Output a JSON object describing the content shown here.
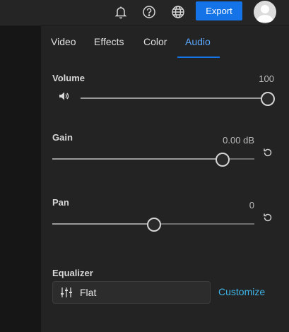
{
  "toolbar": {
    "export_label": "Export",
    "accent_color": "#1473e6",
    "icons": [
      "bell-icon",
      "help-icon",
      "globe-icon"
    ]
  },
  "tabs": [
    {
      "label": "Video",
      "active": false
    },
    {
      "label": "Effects",
      "active": false
    },
    {
      "label": "Color",
      "active": false
    },
    {
      "label": "Audio",
      "active": true
    }
  ],
  "audio": {
    "volume": {
      "label": "Volume",
      "value": "100",
      "level": 1.0,
      "icon": "speaker-icon"
    },
    "gain": {
      "label": "Gain",
      "value": "0.00 dB",
      "level": 0.84,
      "reset_icon": "reset-icon"
    },
    "pan": {
      "label": "Pan",
      "value": "0",
      "level": 0.5,
      "reset_icon": "reset-icon"
    },
    "equalizer": {
      "label": "Equalizer",
      "preset": "Flat",
      "icon": "equalizer-sliders-icon",
      "customize_label": "Customize"
    }
  }
}
